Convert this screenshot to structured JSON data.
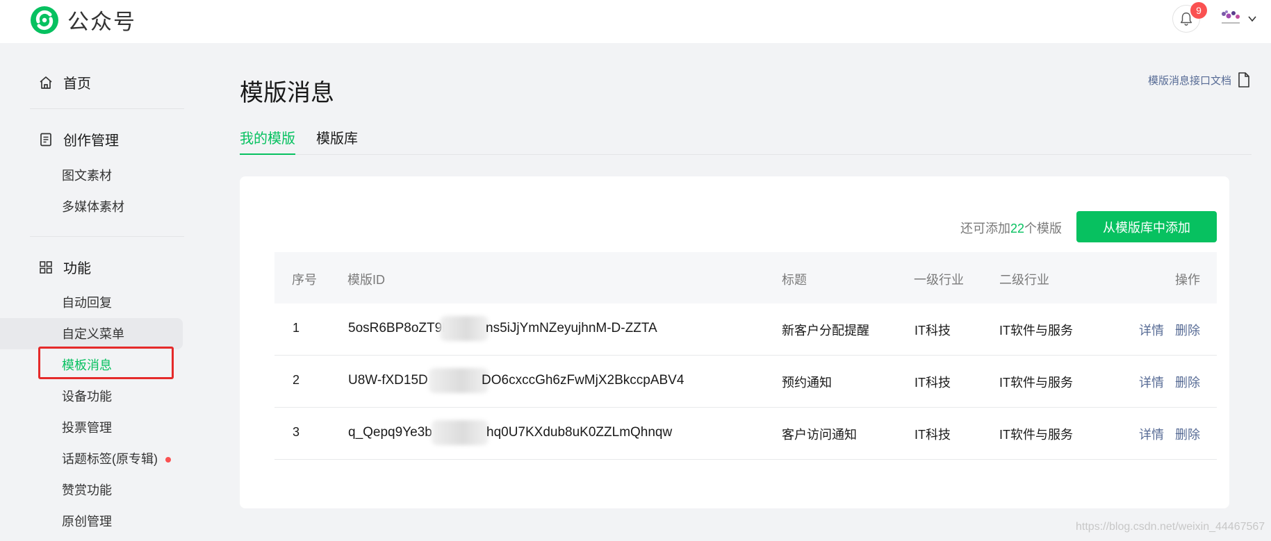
{
  "header": {
    "app_name": "公众号",
    "notification_count": "9",
    "brand_color": "#07c160"
  },
  "sidebar": {
    "home": {
      "label": "首页",
      "icon": "home-icon"
    },
    "creation": {
      "label": "创作管理",
      "icon": "document-icon",
      "items": [
        {
          "label": "图文素材"
        },
        {
          "label": "多媒体素材"
        }
      ]
    },
    "features": {
      "label": "功能",
      "icon": "grid-icon",
      "items": [
        {
          "label": "自动回复"
        },
        {
          "label": "自定义菜单"
        },
        {
          "label": "模板消息",
          "active": true
        },
        {
          "label": "设备功能"
        },
        {
          "label": "投票管理"
        },
        {
          "label": "话题标签(原专辑)",
          "dot": true
        },
        {
          "label": "赞赏功能"
        },
        {
          "label": "原创管理"
        }
      ]
    }
  },
  "main": {
    "title": "模版消息",
    "doc_link": "模版消息接口文档",
    "tabs": [
      {
        "label": "我的模版",
        "active": true
      },
      {
        "label": "模版库",
        "active": false
      }
    ],
    "quota": {
      "prefix": "还可添加",
      "count": "22",
      "suffix": "个模版"
    },
    "add_button": "从模版库中添加",
    "table": {
      "headers": {
        "index": "序号",
        "template_id": "模版ID",
        "title": "标题",
        "industry1": "一级行业",
        "industry2": "二级行业",
        "actions": "操作"
      },
      "rows": [
        {
          "index": "1",
          "id_start": "5osR6BP8oZT9L",
          "id_end": "ns5iJjYmNZeyujhnM-D-ZZTA",
          "title": "新客户分配提醒",
          "industry1": "IT科技",
          "industry2": "IT软件与服务",
          "detail": "详情",
          "delete": "删除"
        },
        {
          "index": "2",
          "id_start": "U8W-fXD15D",
          "id_end": "DO6cxccGh6zFwMjX2BkccpABV4",
          "title": "预约通知",
          "industry1": "IT科技",
          "industry2": "IT软件与服务",
          "detail": "详情",
          "delete": "删除"
        },
        {
          "index": "3",
          "id_start": "q_Qepq9Ye3b",
          "id_end": "hq0U7KXdub8uK0ZZLmQhnqw",
          "title": "客户访问通知",
          "industry1": "IT科技",
          "industry2": "IT软件与服务",
          "detail": "详情",
          "delete": "删除"
        }
      ]
    }
  },
  "watermark": "https://blog.csdn.net/weixin_44467567"
}
